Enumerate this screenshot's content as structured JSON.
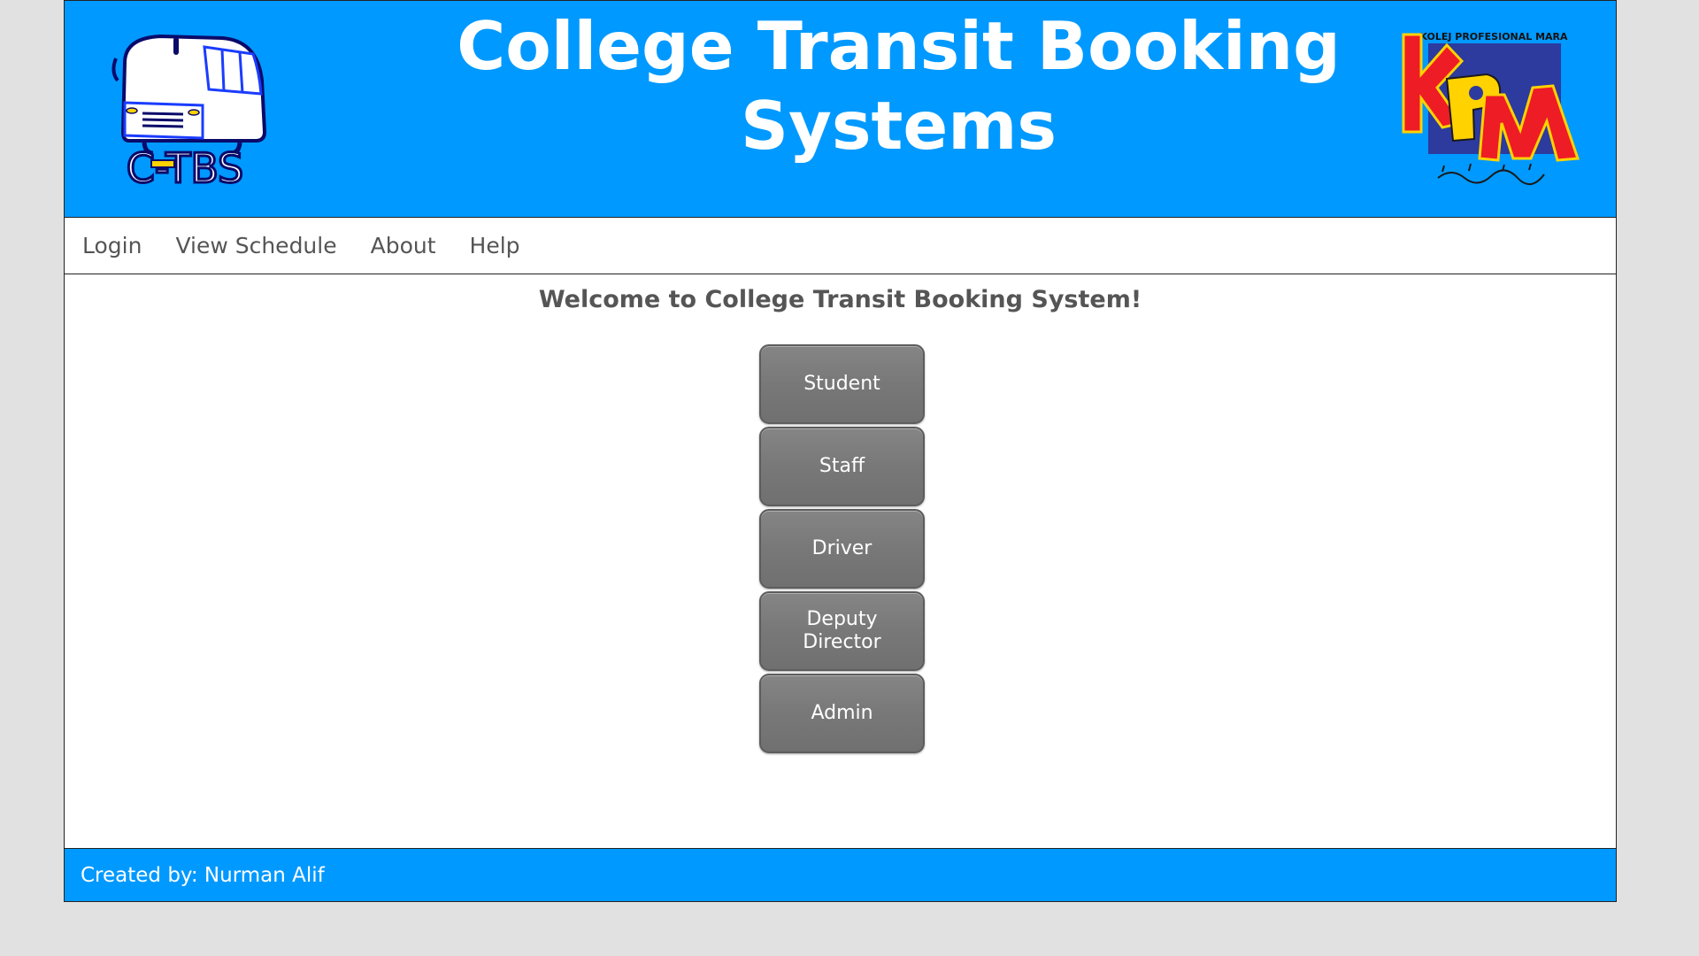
{
  "header": {
    "title": "College Transit Booking Systems",
    "left_logo": {
      "icon": "bus-logo-icon",
      "text": "C-TBS"
    },
    "right_logo": {
      "icon": "kpm-logo-icon",
      "top_text": "KOLEJ PROFESIONAL MARA",
      "letters": "KPM"
    }
  },
  "nav": {
    "items": [
      {
        "label": "Login"
      },
      {
        "label": "View Schedule"
      },
      {
        "label": "About"
      },
      {
        "label": "Help"
      }
    ]
  },
  "main": {
    "welcome": "Welcome to College Transit Booking System!",
    "roles": [
      {
        "label": "Student"
      },
      {
        "label": "Staff"
      },
      {
        "label": "Driver"
      },
      {
        "label": "Deputy Director"
      },
      {
        "label": "Admin"
      }
    ]
  },
  "footer": {
    "text": "Created by: Nurman Alif"
  },
  "colors": {
    "brand_blue": "#0099ff",
    "button_gray": "#777777",
    "text_gray": "#555555",
    "background": "#e1e1e1"
  }
}
